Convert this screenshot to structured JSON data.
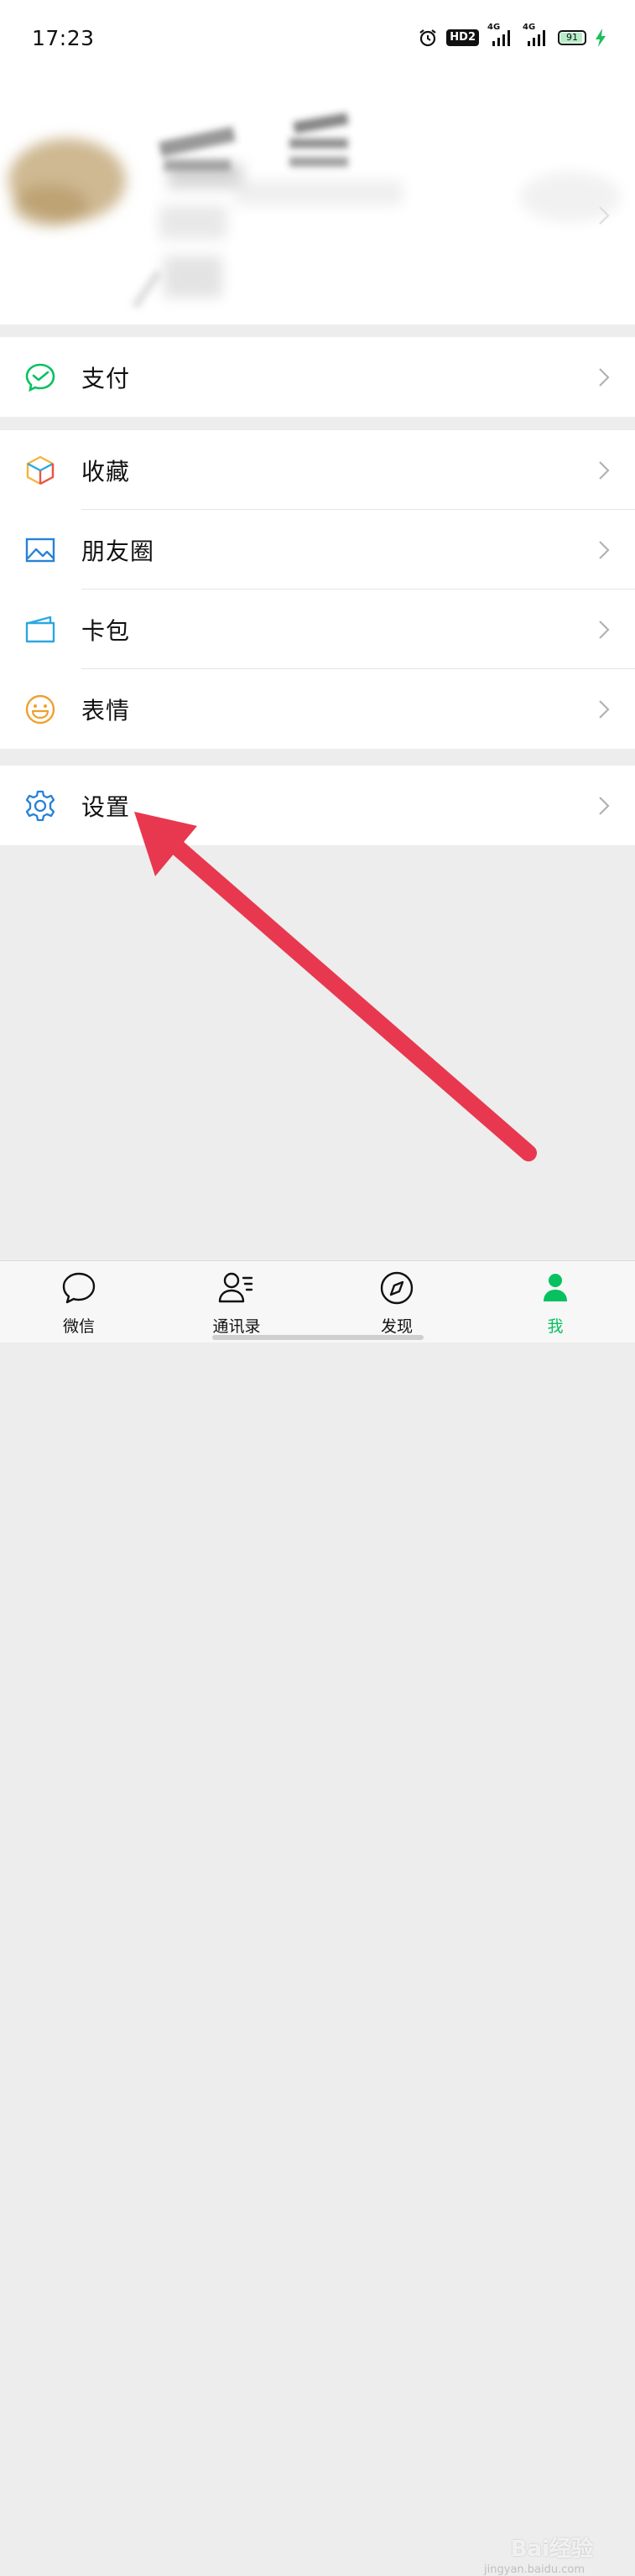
{
  "status_bar": {
    "time": "17:23",
    "hd_label": "HD2",
    "network_1": "4G",
    "network_2": "4G",
    "battery_level": "91",
    "icons": [
      "alarm-icon",
      "hd-voice-icon",
      "signal-icon",
      "signal-icon",
      "battery-icon",
      "charging-icon"
    ]
  },
  "menu": {
    "pay": {
      "label": "支付",
      "icon": "wechat-pay-icon",
      "color": "#07c160"
    },
    "favorites": {
      "label": "收藏",
      "icon": "cube-icon"
    },
    "moments": {
      "label": "朋友圈",
      "icon": "photo-icon",
      "color": "#2782d7"
    },
    "cards": {
      "label": "卡包",
      "icon": "card-wallet-icon",
      "color": "#2aa8e0"
    },
    "stickers": {
      "label": "表情",
      "icon": "smiley-icon",
      "color": "#f0a030"
    },
    "settings": {
      "label": "设置",
      "icon": "gear-icon",
      "color": "#2782d7"
    }
  },
  "tabbar": {
    "tabs": [
      {
        "label": "微信",
        "icon": "chat-bubble-icon",
        "active": false
      },
      {
        "label": "通讯录",
        "icon": "contacts-icon",
        "active": false
      },
      {
        "label": "发现",
        "icon": "compass-icon",
        "active": false
      },
      {
        "label": "我",
        "icon": "person-icon",
        "active": true
      }
    ],
    "active_color": "#07c160"
  },
  "watermark": {
    "text": "Bai经验",
    "sub": "jingyan.baidu.com"
  },
  "annotation": {
    "arrow_color": "#e8384f"
  }
}
